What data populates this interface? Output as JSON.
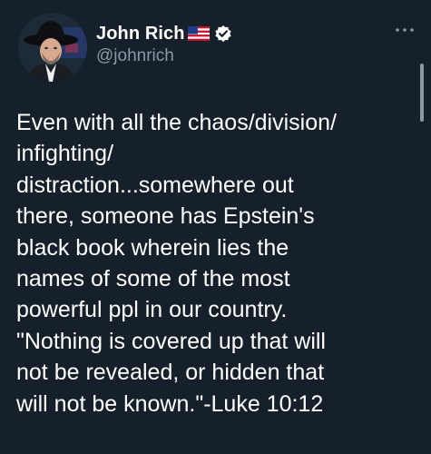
{
  "author": {
    "display_name": "John Rich",
    "handle": "@johnrich",
    "flag_icon": "us-flag-icon",
    "verified_icon": "verified-badge-icon",
    "avatar_icon": "profile-avatar"
  },
  "menu": {
    "icon": "more-options-icon"
  },
  "tweet": {
    "lines": [
      "Even with all the chaos/division/",
      "infighting/",
      "distraction...somewhere out",
      "there, someone has Epstein's",
      "black book wherein lies the",
      "names of some of the most",
      "powerful ppl in our country.",
      "\"Nothing is covered up that will",
      "not be revealed, or hidden that",
      "will not be known.\"-Luke 10:12"
    ]
  },
  "colors": {
    "background": "#15202b",
    "primary_text": "#ffffff",
    "secondary_text": "#8b98a5"
  }
}
